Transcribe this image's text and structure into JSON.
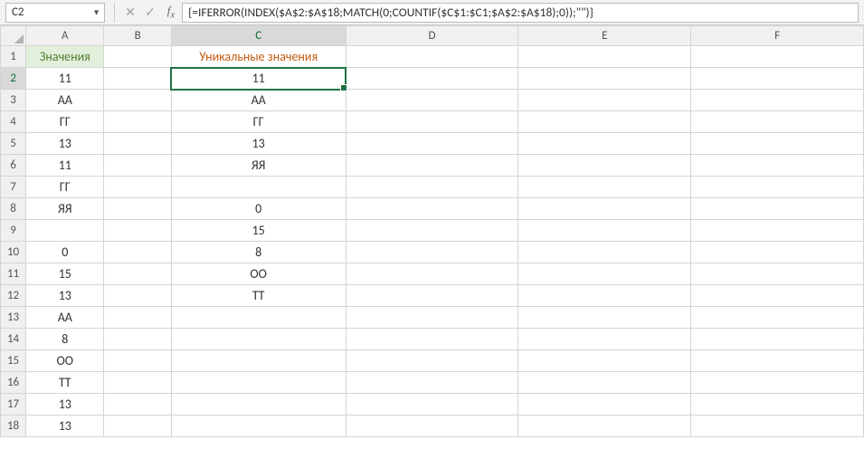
{
  "nameBox": "C2",
  "formula": "{=IFERROR(INDEX($A$2:$A$18;MATCH(0;COUNTIF($C$1:$C1;$A$2:$A$18);0));\"\")}",
  "columns": [
    "A",
    "B",
    "C",
    "D",
    "E",
    "F"
  ],
  "headerRow": {
    "A": "Значения",
    "C": "Уникальные значения"
  },
  "rows": [
    {
      "n": "2",
      "A": "11",
      "C": "11"
    },
    {
      "n": "3",
      "A": "АА",
      "C": "АА"
    },
    {
      "n": "4",
      "A": "ГГ",
      "C": "ГГ"
    },
    {
      "n": "5",
      "A": "13",
      "C": "13"
    },
    {
      "n": "6",
      "A": "11",
      "C": "ЯЯ"
    },
    {
      "n": "7",
      "A": "ГГ",
      "C": ""
    },
    {
      "n": "8",
      "A": "ЯЯ",
      "C": "0"
    },
    {
      "n": "9",
      "A": "",
      "C": "15"
    },
    {
      "n": "10",
      "A": "0",
      "C": "8"
    },
    {
      "n": "11",
      "A": "15",
      "C": "ОО"
    },
    {
      "n": "12",
      "A": "13",
      "C": "ТТ"
    },
    {
      "n": "13",
      "A": "АА",
      "C": ""
    },
    {
      "n": "14",
      "A": "8",
      "C": ""
    },
    {
      "n": "15",
      "A": "ОО",
      "C": ""
    },
    {
      "n": "16",
      "A": "ТТ",
      "C": ""
    },
    {
      "n": "17",
      "A": "13",
      "C": ""
    },
    {
      "n": "18",
      "A": "13",
      "C": ""
    }
  ],
  "activeCell": {
    "row": "2",
    "col": "C"
  }
}
